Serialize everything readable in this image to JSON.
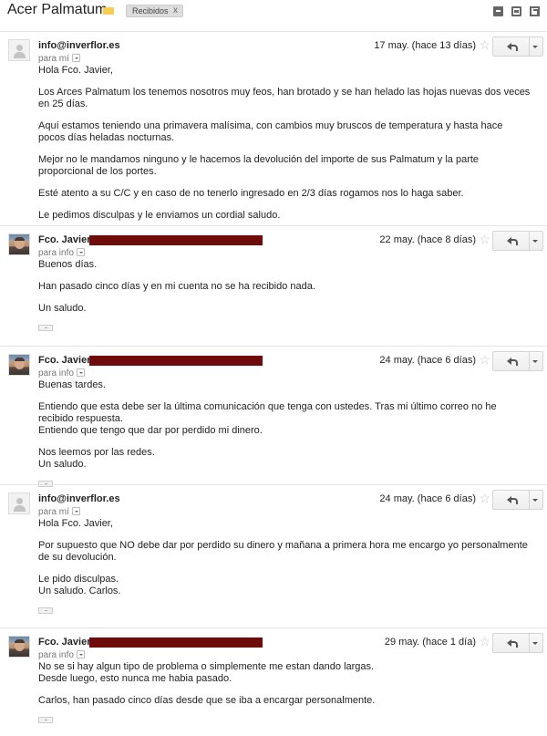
{
  "header": {
    "subject": "Acer Palmatum",
    "label": "Recibidos",
    "label_close": "x",
    "icons": [
      "archive-icon",
      "print-icon",
      "new-window-icon"
    ]
  },
  "messages": [
    {
      "sender": "info@inverflor.es",
      "to": "para mí",
      "date": "17 may. (hace 13 días)",
      "avatar": "default",
      "paragraphs": [
        "Hola Fco. Javier,",
        "Los Arces Palmatum los tenemos nosotros muy feos, han brotado y se han helado las hojas nuevas dos veces en 25 días.",
        "Aquí estamos teniendo una primavera malísima, con cambios muy bruscos de temperatura y hasta hace pocos días heladas nocturnas.",
        "Mejor no le mandamos ninguno y le hacemos la devolución del importe de sus Palmatum y la parte proporcional de los portes.",
        "Esté atento a su C/C y en caso de no tenerlo ingresado en 2/3 días rogamos nos lo haga saber.",
        "Le pedimos disculpas y le enviamos un cordial saludo."
      ]
    },
    {
      "sender": "Fco. Javier",
      "to": "para info",
      "date": "22 may. (hace 8 días)",
      "avatar": "photo",
      "paragraphs": [
        "Buenos días.",
        "Han pasado cinco días y en mi cuenta no se ha recibido nada.",
        "Un saludo."
      ],
      "ellipsis": "..."
    },
    {
      "sender": "Fco. Javier",
      "to": "para info",
      "date": "24 may. (hace 6 días)",
      "avatar": "photo",
      "paragraphs": [
        "Buenas tardes.",
        "Entiendo que esta debe ser la última comunicación que tenga con ustedes. Tras mi último correo no he recibido respuesta.\nEntiendo que tengo que dar por perdido mi dinero.",
        "Nos leemos por las redes.\nUn saludo."
      ],
      "ellipsis": "..."
    },
    {
      "sender": "info@inverflor.es",
      "to": "para mí",
      "date": "24 may. (hace 6 días)",
      "avatar": "default",
      "paragraphs": [
        "Hola Fco. Javier,",
        "Por supuesto que NO debe dar por perdido su dinero y mañana a primera hora me encargo yo personalmente de su devolución.",
        "Le pido disculpas.\nUn saludo. Carlos."
      ],
      "ellipsis": "..."
    },
    {
      "sender": "Fco. Javier",
      "to": "para info",
      "date": "29 may. (hace 1 día)",
      "avatar": "photo",
      "paragraphs": [
        "No se si hay algun tipo de problema o simplemente me estan dando largas.\nDesde luego, esto nunca me habia pasado.",
        "Carlos, han pasado cinco días desde que se iba a encargar personalmente."
      ],
      "ellipsis": "..."
    }
  ]
}
